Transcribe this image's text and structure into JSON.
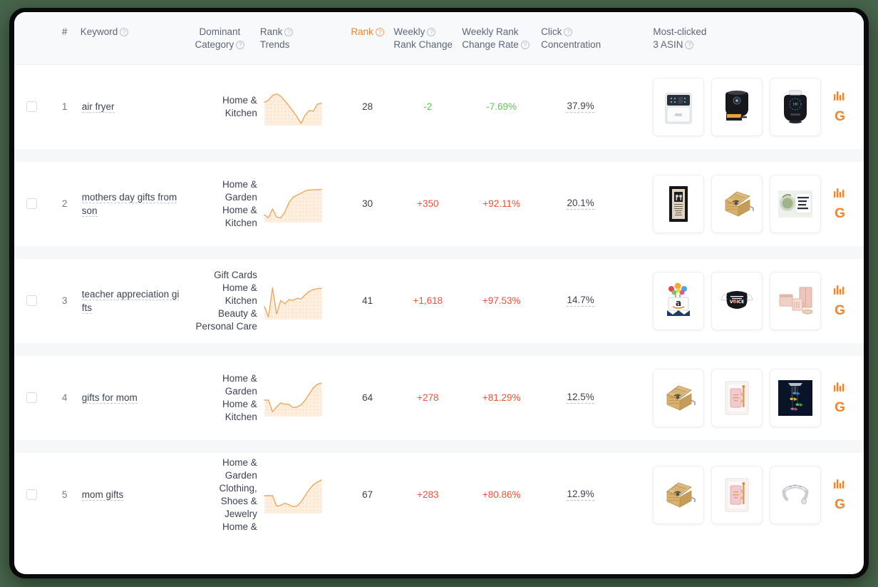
{
  "table": {
    "columns": [
      {
        "key": "index",
        "label": "#",
        "help": false
      },
      {
        "key": "keyword",
        "label": "Keyword",
        "help": true
      },
      {
        "key": "category",
        "label_line1": "Dominant",
        "label_line2": "Category",
        "help": true
      },
      {
        "key": "trend",
        "label_line1": "Rank",
        "label_line2": "Trends",
        "help": true
      },
      {
        "key": "rank",
        "label": "Rank",
        "help": true,
        "accent": true
      },
      {
        "key": "weekly_rank_change",
        "label_line1": "Weekly",
        "label_line2": "Rank Change",
        "help": true
      },
      {
        "key": "weekly_rank_change_rate",
        "label_line1": "Weekly Rank",
        "label_line2": "Change Rate",
        "help": true
      },
      {
        "key": "click_concentration",
        "label_line1": "Click",
        "label_line2": "Concentration",
        "help": true
      },
      {
        "key": "most_clicked",
        "label_line1": "Most-clicked",
        "label_line2": "3 ASIN",
        "help": true
      }
    ],
    "help_glyph": "?",
    "rows": [
      {
        "index": "1",
        "keyword": "air fryer",
        "categories": [
          "Home &",
          "Kitchen"
        ],
        "rank": "28",
        "weekly_rank_change": "-2",
        "weekly_rank_change_dir": "down",
        "weekly_rank_change_rate": "-7.69%",
        "weekly_rank_change_rate_dir": "down",
        "click_concentration": "37.9%",
        "asins": [
          "white-air-fryer",
          "black-air-fryer-open",
          "black-air-fryer-digital"
        ]
      },
      {
        "index": "2",
        "keyword": "mothers day gifts from son",
        "categories": [
          "Home &",
          "Garden",
          "Home &",
          "Kitchen"
        ],
        "rank": "30",
        "weekly_rank_change": "+350",
        "weekly_rank_change_dir": "up",
        "weekly_rank_change_rate": "+92.11%",
        "weekly_rank_change_rate_dir": "up",
        "click_concentration": "20.1%",
        "asins": [
          "framed-wall-art",
          "wooden-music-box",
          "quote-mug"
        ]
      },
      {
        "index": "3",
        "keyword": "teacher appreciation gifts",
        "categories": [
          "Gift Cards",
          "Home &",
          "Kitchen",
          "Beauty &",
          "Personal Care"
        ],
        "rank": "41",
        "weekly_rank_change": "+1,618",
        "weekly_rank_change_dir": "up",
        "weekly_rank_change_rate": "+97.53%",
        "weekly_rank_change_rate_dir": "up",
        "click_concentration": "14.7%",
        "asins": [
          "amazon-gift-card-flowers",
          "black-face-mask",
          "pink-mug-gift-set"
        ]
      },
      {
        "index": "4",
        "keyword": "gifts for mom",
        "categories": [
          "Home &",
          "Garden",
          "Home &",
          "Kitchen"
        ],
        "rank": "64",
        "weekly_rank_change": "+278",
        "weekly_rank_change_dir": "up",
        "weekly_rank_change_rate": "+81.29%",
        "weekly_rank_change_rate_dir": "up",
        "click_concentration": "12.5%",
        "asins": [
          "wooden-music-box",
          "pink-mug-boxed",
          "hummingbird-wind-chime"
        ]
      },
      {
        "index": "5",
        "keyword": "mom gifts",
        "categories": [
          "Home &",
          "Garden",
          "Clothing,",
          "Shoes &",
          "Jewelry",
          "Home &"
        ],
        "rank": "67",
        "weekly_rank_change": "+283",
        "weekly_rank_change_dir": "up",
        "weekly_rank_change_rate": "+80.86%",
        "weekly_rank_change_rate_dir": "up",
        "click_concentration": "12.9%",
        "asins": [
          "wooden-music-box",
          "pink-mug-boxed",
          "silver-bangle-bracelet"
        ]
      }
    ],
    "actions": {
      "chart_icon": "bar-chart-icon",
      "google_icon": "G"
    }
  },
  "colors": {
    "accent": "#f0852b",
    "increase": "#f0523c",
    "decrease": "#61c454",
    "text": "#3b4252",
    "muted": "#5c6678",
    "header_bg": "#f8f9fa",
    "spacer_bg": "#f6f7f9",
    "page_bg": "#47654b"
  },
  "chart_data": [
    {
      "type": "area",
      "title": "Rank Trends - air fryer",
      "x": [
        0,
        1,
        2,
        3,
        4,
        5,
        6,
        7,
        8,
        9,
        10,
        11,
        12,
        13,
        14
      ],
      "values": [
        68,
        74,
        88,
        92,
        86,
        72,
        58,
        42,
        26,
        6,
        30,
        44,
        42,
        62,
        66
      ],
      "ylim": [
        0,
        100
      ],
      "grid": false
    },
    {
      "type": "area",
      "title": "Rank Trends - mothers day gifts from son",
      "x": [
        0,
        1,
        2,
        3,
        4,
        5,
        6,
        7,
        8,
        9,
        10,
        11,
        12,
        13,
        14
      ],
      "values": [
        22,
        14,
        40,
        16,
        14,
        30,
        58,
        74,
        80,
        86,
        92,
        95,
        96,
        96,
        97
      ],
      "ylim": [
        0,
        100
      ],
      "grid": false
    },
    {
      "type": "area",
      "title": "Rank Trends - teacher appreciation gifts",
      "x": [
        0,
        1,
        2,
        3,
        4,
        5,
        6,
        7,
        8,
        9,
        10,
        11,
        12,
        13,
        14
      ],
      "values": [
        38,
        8,
        92,
        16,
        56,
        46,
        58,
        56,
        62,
        60,
        72,
        82,
        88,
        90,
        91
      ],
      "ylim": [
        0,
        100
      ],
      "grid": false
    },
    {
      "type": "area",
      "title": "Rank Trends - gifts for mom",
      "x": [
        0,
        1,
        2,
        3,
        4,
        5,
        6,
        7,
        8,
        9,
        10,
        11,
        12,
        13,
        14
      ],
      "values": [
        48,
        48,
        14,
        28,
        40,
        36,
        36,
        26,
        28,
        34,
        48,
        66,
        84,
        94,
        98
      ],
      "ylim": [
        0,
        100
      ],
      "grid": false
    },
    {
      "type": "area",
      "title": "Rank Trends - mom gifts",
      "x": [
        0,
        1,
        2,
        3,
        4,
        5,
        6,
        7,
        8,
        9,
        10,
        11,
        12,
        13,
        14
      ],
      "values": [
        52,
        52,
        52,
        22,
        24,
        30,
        26,
        20,
        22,
        34,
        52,
        70,
        84,
        92,
        98
      ],
      "ylim": [
        0,
        100
      ],
      "grid": false
    }
  ]
}
